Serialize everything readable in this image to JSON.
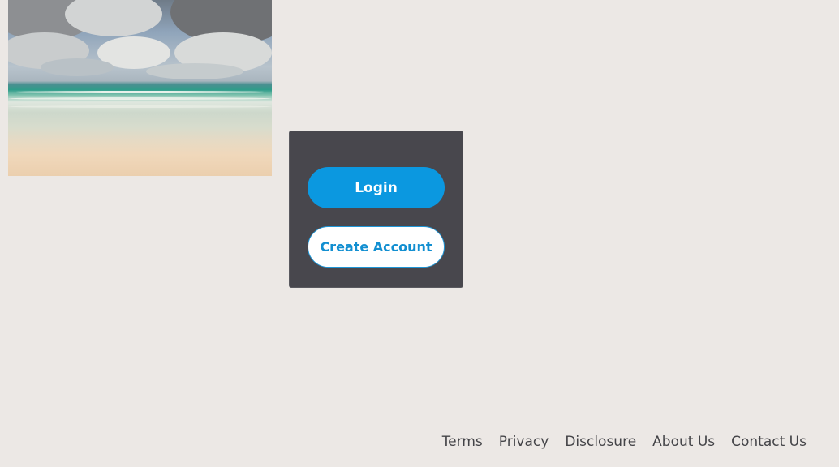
{
  "hero_image": {
    "alt": "Beach with ocean waves and cloudy sky"
  },
  "auth_panel": {
    "login_label": "Login",
    "create_account_label": "Create Account"
  },
  "footer": {
    "links": [
      "Terms",
      "Privacy",
      "Disclosure",
      "About Us",
      "Contact Us"
    ]
  },
  "colors": {
    "background": "#ece8e5",
    "panel": "#48474d",
    "primary_button": "#0b98e0",
    "secondary_button_text": "#128fd1",
    "footer_link": "#444448"
  }
}
